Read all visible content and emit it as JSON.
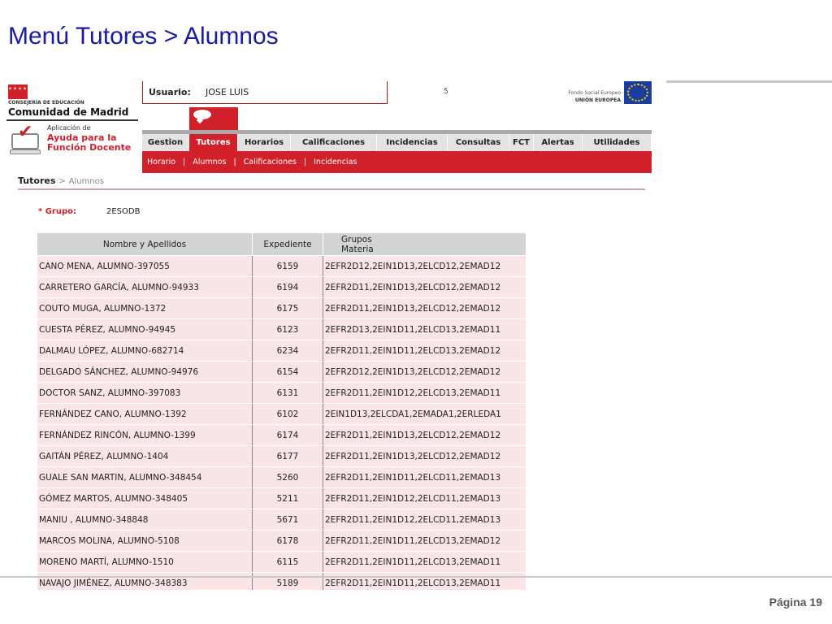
{
  "slide": {
    "title": "Menú Tutores > Alumnos",
    "page": "Página 19"
  },
  "logo": {
    "consejeria": "CONSEJERÍA DE EDUCACIÓN",
    "comunidad": "Comunidad de Madrid",
    "app_line1": "Aplicación de",
    "app_line2": "Ayuda para la",
    "app_line3": "Función Docente"
  },
  "user": {
    "label": "Usuario:",
    "name": "JOSE LUIS",
    "stray": "5"
  },
  "eu": {
    "line1": "Fondo Social Europeo",
    "line2": "UNIÓN EUROPEA"
  },
  "nav": {
    "tabs": [
      "Gestion",
      "Tutores",
      "Horarios",
      "Calificaciones",
      "Incidencias",
      "Consultas",
      "FCT",
      "Alertas",
      "Utilidades"
    ],
    "active": "Tutores",
    "subnav": [
      "Horario",
      "Alumnos",
      "Calificaciones",
      "Incidencias"
    ],
    "separator": "|"
  },
  "breadcrumb": {
    "main": "Tutores",
    "separator": ">",
    "sub": "Alumnos"
  },
  "grupo": {
    "label": "* Grupo:",
    "value": "2ESODB"
  },
  "table": {
    "headers": [
      "Nombre y Apellidos",
      "Expediente",
      "Grupos",
      "Materia"
    ],
    "rows": [
      [
        "CANO MENA, ALUMNO-397055",
        "6159",
        "2EFR2D12,2EIN1D13,2ELCD12,2EMAD12"
      ],
      [
        "CARRETERO GARCÍA, ALUMNO-94933",
        "6194",
        "2EFR2D11,2EIN1D13,2ELCD12,2EMAD12"
      ],
      [
        "COUTO MUGA, ALUMNO-1372",
        "6175",
        "2EFR2D11,2EIN1D13,2ELCD12,2EMAD12"
      ],
      [
        "CUESTA PÉREZ, ALUMNO-94945",
        "6123",
        "2EFR2D13,2EIN1D11,2ELCD13,2EMAD11"
      ],
      [
        "DALMAU LÓPEZ, ALUMNO-682714",
        "6234",
        "2EFR2D11,2EIN1D11,2ELCD13,2EMAD12"
      ],
      [
        "DELGADO SÁNCHEZ, ALUMNO-94976",
        "6154",
        "2EFR2D12,2EIN1D13,2ELCD12,2EMAD12"
      ],
      [
        "DOCTOR SANZ, ALUMNO-397083",
        "6131",
        "2EFR2D11,2EIN1D12,2ELCD13,2EMAD11"
      ],
      [
        "FERNÁNDEZ CANO, ALUMNO-1392",
        "6102",
        "2EIN1D13,2ELCDA1,2EMADA1,2ERLEDA1"
      ],
      [
        "FERNÁNDEZ RINCÓN, ALUMNO-1399",
        "6174",
        "2EFR2D11,2EIN1D13,2ELCD12,2EMAD12"
      ],
      [
        "GAITÁN PÉREZ, ALUMNO-1404",
        "6177",
        "2EFR2D11,2EIN1D13,2ELCD12,2EMAD12"
      ],
      [
        "GUALE SAN MARTIN, ALUMNO-348454",
        "5260",
        "2EFR2D11,2EIN1D11,2ELCD11,2EMAD13"
      ],
      [
        "GÓMEZ MARTOS, ALUMNO-348405",
        "5211",
        "2EFR2D11,2EIN1D12,2ELCD11,2EMAD13"
      ],
      [
        "MANIU , ALUMNO-348848",
        "5671",
        "2EFR2D11,2EIN1D12,2ELCD11,2EMAD13"
      ],
      [
        "MARCOS MOLINA, ALUMNO-5108",
        "6178",
        "2EFR2D11,2EIN1D11,2ELCD13,2EMAD12"
      ],
      [
        "MORENO MARTÍ, ALUMNO-1510",
        "6115",
        "2EFR2D11,2EIN1D11,2ELCD13,2EMAD11"
      ],
      [
        "NAVAJO JIMÉNEZ, ALUMNO-348383",
        "5189",
        "2EFR2D11,2EIN1D11,2ELCD13,2EMAD11"
      ]
    ]
  },
  "colors": {
    "accent_red": "#d0202a",
    "title_blue": "#1a1aa6",
    "row_pink": "#f9e5e5",
    "header_gray": "#d3d3d3"
  }
}
